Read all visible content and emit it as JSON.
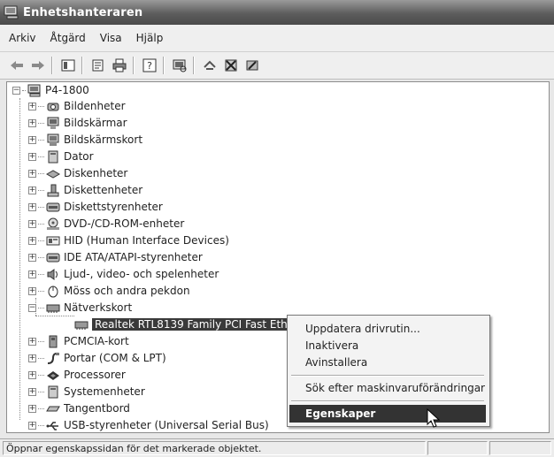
{
  "window": {
    "title": "Enhetshanteraren"
  },
  "menu": [
    "Arkiv",
    "Åtgärd",
    "Visa",
    "Hjälp"
  ],
  "toolbar": {
    "buttons": [
      "back-icon",
      "forward-icon",
      "console-tree-icon",
      "properties-icon",
      "print-icon",
      "help-icon",
      "scan-hardware-icon",
      "uninstall-icon",
      "disable-icon",
      "update-driver-icon"
    ]
  },
  "tree": {
    "root": "P4-1800",
    "categories": [
      "Bildenheter",
      "Bildskärmar",
      "Bildskärmskort",
      "Dator",
      "Diskenheter",
      "Diskettenheter",
      "Diskettstyrenheter",
      "DVD-/CD-ROM-enheter",
      "HID (Human Interface Devices)",
      "IDE ATA/ATAPI-styrenheter",
      "Ljud-, video- och spelenheter",
      "Möss och andra pekdon",
      "Nätverkskort",
      "PCMCIA-kort",
      "Portar (COM & LPT)",
      "Processorer",
      "Systemenheter",
      "Tangentbord",
      "USB-styrenheter (Universal Serial Bus)"
    ],
    "selected_child": "Realtek RTL8139 Family PCI Fast Ethernet NIC"
  },
  "context_menu": {
    "items": [
      "Uppdatera drivrutin...",
      "Inaktivera",
      "Avinstallera",
      "Sök efter maskinvaruförändringar",
      "Egenskaper"
    ]
  },
  "status": {
    "text": "Öppnar egenskapssidan för det markerade objektet."
  }
}
